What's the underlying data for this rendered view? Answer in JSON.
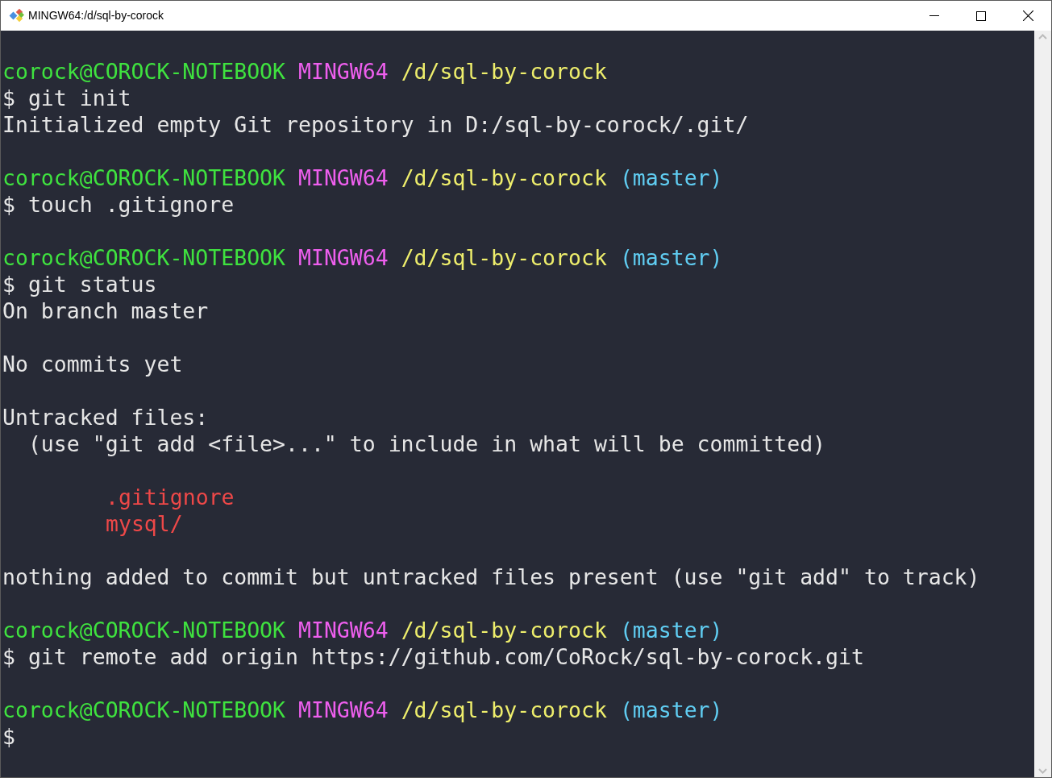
{
  "window": {
    "title": "MINGW64:/d/sql-by-corock"
  },
  "lines": [
    {
      "kind": "blank"
    },
    {
      "kind": "prompt",
      "user": "corock@COROCK-NOTEBOOK",
      "system": "MINGW64",
      "path": "/d/sql-by-corock"
    },
    {
      "kind": "command",
      "text": "$ git init"
    },
    {
      "kind": "output",
      "text": "Initialized empty Git repository in D:/sql-by-corock/.git/"
    },
    {
      "kind": "blank"
    },
    {
      "kind": "prompt",
      "user": "corock@COROCK-NOTEBOOK",
      "system": "MINGW64",
      "path": "/d/sql-by-corock",
      "branch": "(master)"
    },
    {
      "kind": "command",
      "text": "$ touch .gitignore"
    },
    {
      "kind": "blank"
    },
    {
      "kind": "prompt",
      "user": "corock@COROCK-NOTEBOOK",
      "system": "MINGW64",
      "path": "/d/sql-by-corock",
      "branch": "(master)"
    },
    {
      "kind": "command",
      "text": "$ git status"
    },
    {
      "kind": "output",
      "text": "On branch master"
    },
    {
      "kind": "blank"
    },
    {
      "kind": "output",
      "text": "No commits yet"
    },
    {
      "kind": "blank"
    },
    {
      "kind": "output",
      "text": "Untracked files:"
    },
    {
      "kind": "output",
      "text": "  (use \"git add <file>...\" to include in what will be committed)"
    },
    {
      "kind": "blank"
    },
    {
      "kind": "untracked",
      "text": ".gitignore"
    },
    {
      "kind": "untracked",
      "text": "mysql/"
    },
    {
      "kind": "blank"
    },
    {
      "kind": "output",
      "text": "nothing added to commit but untracked files present (use \"git add\" to track)"
    },
    {
      "kind": "blank"
    },
    {
      "kind": "prompt",
      "user": "corock@COROCK-NOTEBOOK",
      "system": "MINGW64",
      "path": "/d/sql-by-corock",
      "branch": "(master)"
    },
    {
      "kind": "command",
      "text": "$ git remote add origin https://github.com/CoRock/sql-by-corock.git"
    },
    {
      "kind": "blank"
    },
    {
      "kind": "prompt",
      "user": "corock@COROCK-NOTEBOOK",
      "system": "MINGW64",
      "path": "/d/sql-by-corock",
      "branch": "(master)"
    },
    {
      "kind": "command",
      "text": "$"
    }
  ]
}
